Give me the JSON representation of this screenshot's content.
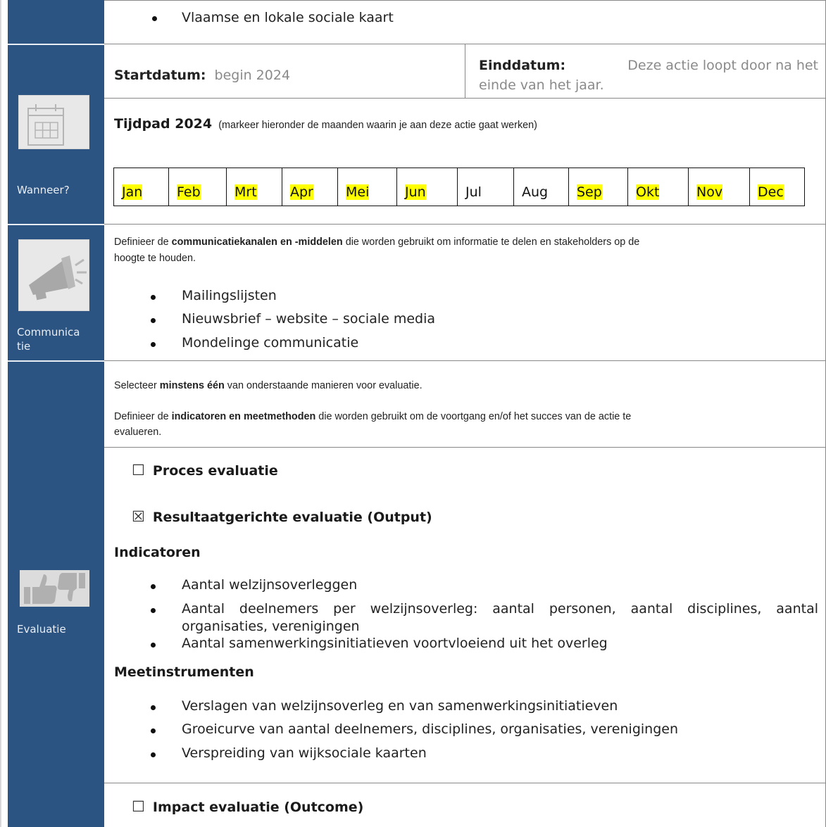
{
  "top_bullet": "Vlaamse en lokale sociale kaart",
  "dates": {
    "start_label": "Startdatum:",
    "start_value": "begin 2024",
    "end_label": "Einddatum:",
    "end_value_line1": "Deze actie loopt door na het",
    "end_value_line2": "einde van het jaar."
  },
  "sidebar": {
    "wanneer": "Wanneer?",
    "communicatie_line1": "Communica",
    "communicatie_line2": "tie",
    "evaluatie": "Evaluatie"
  },
  "timeline": {
    "title": "Tijdpad 2024",
    "subtitle": "(markeer hieronder de maanden waarin je aan deze actie gaat werken)",
    "months": [
      {
        "label": "Jan",
        "highlighted": true
      },
      {
        "label": "Feb",
        "highlighted": true
      },
      {
        "label": "Mrt",
        "highlighted": true
      },
      {
        "label": "Apr",
        "highlighted": true
      },
      {
        "label": "Mei",
        "highlighted": true
      },
      {
        "label": "Jun",
        "highlighted": true
      },
      {
        "label": "Jul",
        "highlighted": false
      },
      {
        "label": "Aug",
        "highlighted": false
      },
      {
        "label": "Sep",
        "highlighted": true
      },
      {
        "label": "Okt",
        "highlighted": true
      },
      {
        "label": "Nov",
        "highlighted": true
      },
      {
        "label": "Dec",
        "highlighted": true
      }
    ],
    "highlight_color": "#ffff00"
  },
  "communicatie": {
    "intro_pre": "Definieer de ",
    "intro_bold": "communicatiekanalen en -middelen",
    "intro_post": " die worden gebruikt om informatie te delen en stakeholders op de",
    "intro_line2": "hoogte te houden.",
    "bullets": [
      "Mailingslijsten",
      "Nieuwsbrief – website – sociale media",
      "Mondelinge communicatie"
    ]
  },
  "evaluatie": {
    "select_pre": "Selecteer ",
    "select_bold": "minstens één",
    "select_post": " van onderstaande manieren voor evaluatie.",
    "define_pre": "Definieer de ",
    "define_bold": "indicatoren en meetmethoden",
    "define_post": " die worden gebruikt om de voortgang en/of het succes van de actie te",
    "define_line2": "evalueren.",
    "proces": {
      "checked": false,
      "glyph": "☐",
      "label": "Proces evaluatie"
    },
    "resultaat": {
      "checked": true,
      "glyph": "☒",
      "label": "Resultaatgerichte evaluatie (Output)"
    },
    "indicatoren_title": "Indicatoren",
    "indicatoren": [
      "Aantal welzijnsoverleggen",
      "Aantal deelnemers per welzijnsoverleg: aantal personen, aantal disciplines, aantal",
      "organisaties, verenigingen",
      "Aantal samenwerkingsinitiatieven voortvloeiend uit het overleg"
    ],
    "meetinstrumenten_title": "Meetinstrumenten",
    "meetinstrumenten": [
      "Verslagen van welzijnsoverleg en van samenwerkingsinitiatieven",
      "Groeicurve van aantal deelnemers, disciplines, organisaties, verenigingen",
      "Verspreiding van wijksociale kaarten"
    ],
    "impact": {
      "checked": false,
      "glyph": "☐",
      "label": "Impact evaluatie (Outcome)"
    }
  },
  "colors": {
    "sidebar": "#2b5482",
    "icon_bg": "#e8e8e8",
    "icon_fg": "#a5a5a5"
  }
}
